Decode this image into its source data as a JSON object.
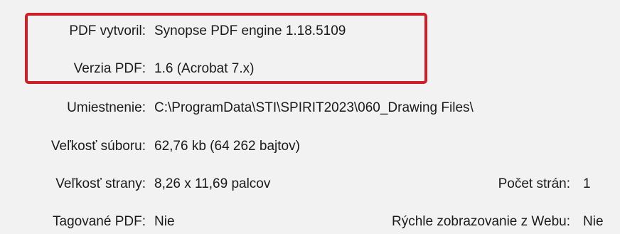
{
  "properties": [
    {
      "label": "PDF vytvoril:",
      "value": "Synopse PDF engine 1.18.5109"
    },
    {
      "label": "Verzia PDF:",
      "value": "1.6 (Acrobat 7.x)"
    },
    {
      "label": "Umiestnenie:",
      "value": "C:\\ProgramData\\STI\\SPIRIT2023\\060_Drawing Files\\"
    },
    {
      "label": "Veľkosť súboru:",
      "value": "62,76 kb (64 262 bajtov)"
    },
    {
      "label": "Veľkosť strany:",
      "value": "8,26 x 11,69 palcov",
      "extra_label": "Počet strán:",
      "extra_value": "1"
    },
    {
      "label": "Tagované PDF:",
      "value": "Nie",
      "extra_label": "Rýchle zobrazovanie z Webu:",
      "extra_value": "Nie"
    }
  ],
  "highlight_color": "#cc1f27"
}
